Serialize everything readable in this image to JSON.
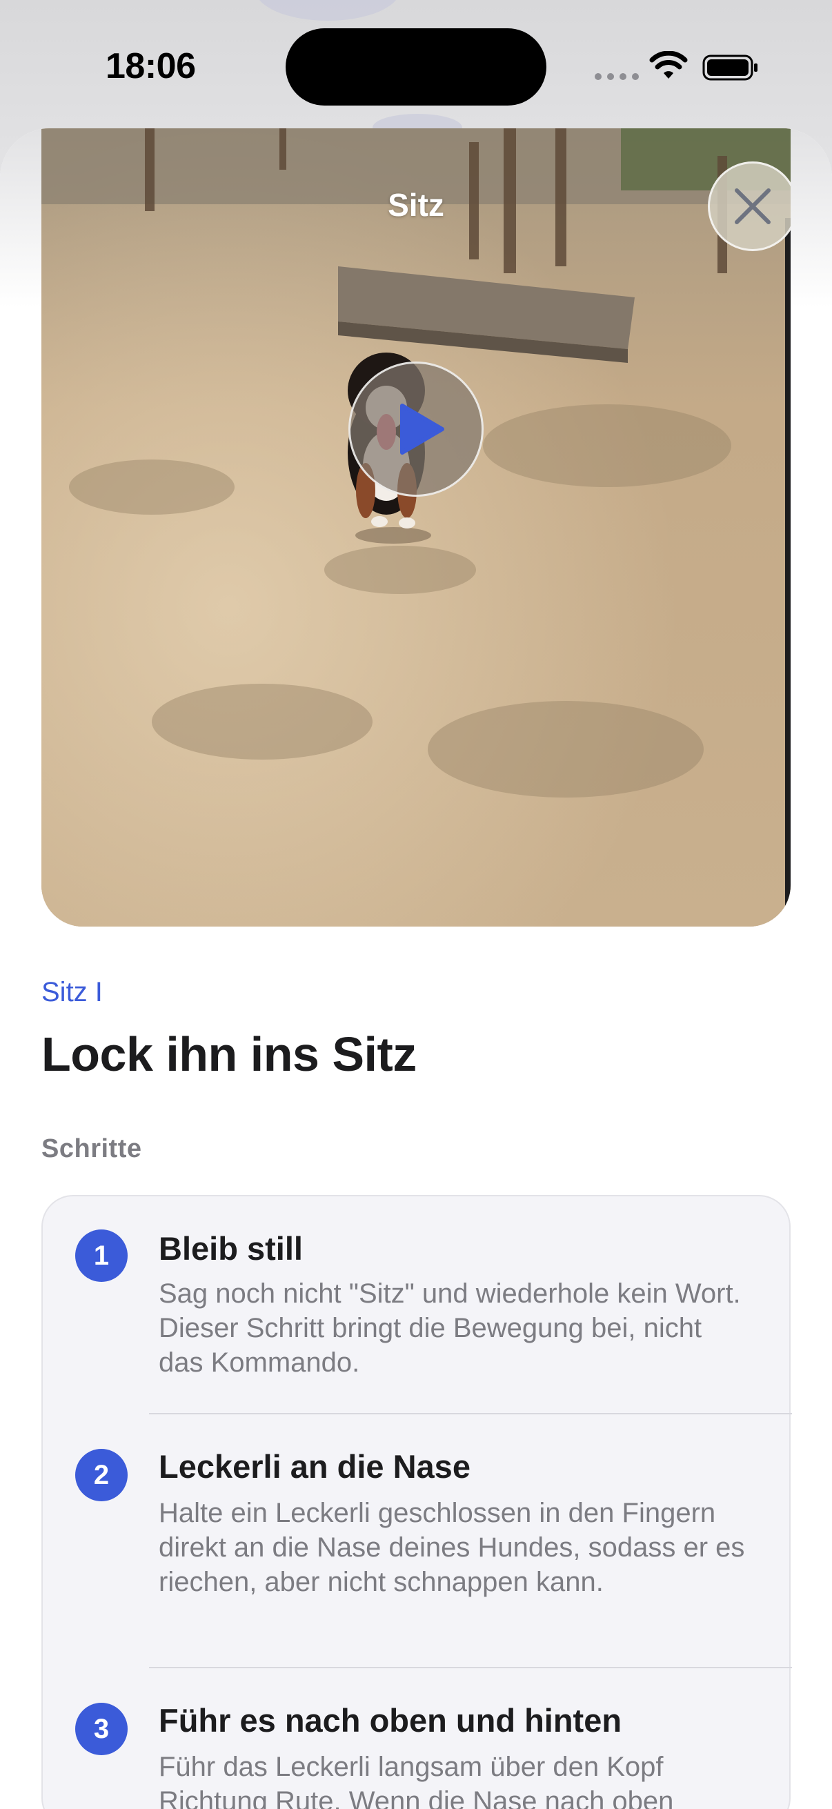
{
  "status_bar": {
    "time": "18:06"
  },
  "video": {
    "title": "Sitz"
  },
  "lesson": {
    "subtitle": "Sitz I",
    "title": "Lock ihn ins Sitz"
  },
  "steps_section": {
    "label": "Schritte",
    "steps": [
      {
        "number": "1",
        "title": "Bleib still",
        "description": "Sag noch nicht \"Sitz\" und wiederhole kein Wort. Dieser Schritt bringt die Bewegung bei, nicht das Kommando."
      },
      {
        "number": "2",
        "title": "Leckerli an die Nase",
        "description": "Halte ein Leckerli geschlossen in den Fingern direkt an die Nase deines Hundes, sodass er es riechen, aber nicht schnappen kann."
      },
      {
        "number": "3",
        "title": "Führ es nach oben und hinten",
        "description": "Führ das Leckerli langsam über den Kopf Richtung Rute. Wenn die Nase nach oben"
      }
    ]
  },
  "colors": {
    "accent": "#3b5bd9",
    "secondary_text": "#7c7c82",
    "card_bg": "#f4f4f8"
  }
}
